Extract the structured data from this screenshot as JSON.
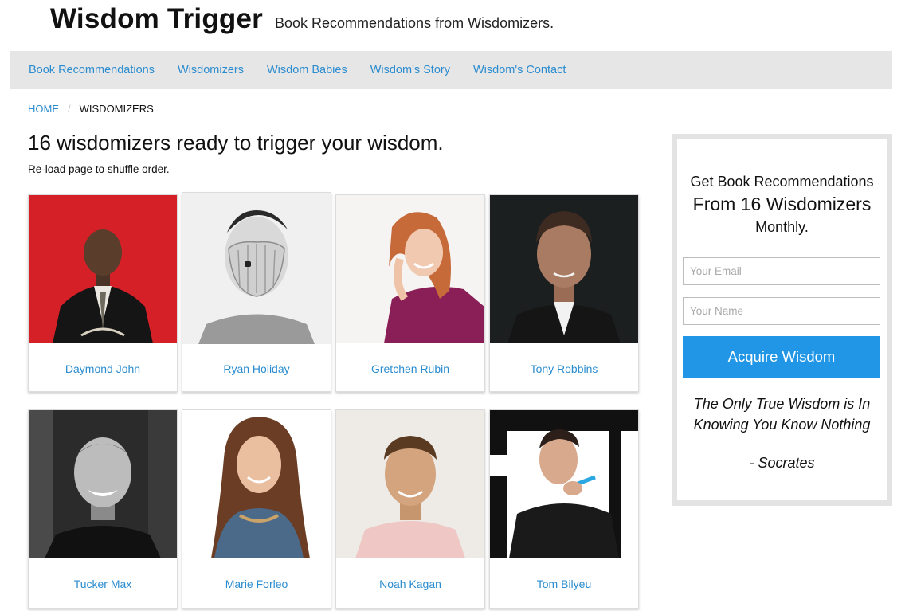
{
  "header": {
    "title": "Wisdom Trigger",
    "tagline": "Book Recommendations from Wisdomizers."
  },
  "nav": {
    "items": [
      {
        "label": "Book Recommendations"
      },
      {
        "label": "Wisdomizers"
      },
      {
        "label": "Wisdom Babies"
      },
      {
        "label": "Wisdom's Story"
      },
      {
        "label": "Wisdom's Contact"
      }
    ]
  },
  "breadcrumb": {
    "home": "HOME",
    "separator": "/",
    "current": "WISDOMIZERS"
  },
  "main": {
    "heading": "16 wisdomizers ready to trigger your wisdom.",
    "note": "Re-load page to shuffle order."
  },
  "wisdomizers": [
    {
      "name": "Daymond John"
    },
    {
      "name": "Ryan Holiday"
    },
    {
      "name": "Gretchen Rubin"
    },
    {
      "name": "Tony Robbins"
    },
    {
      "name": "Tucker Max"
    },
    {
      "name": "Marie Forleo"
    },
    {
      "name": "Noah Kagan"
    },
    {
      "name": "Tom Bilyeu"
    }
  ],
  "sidebar": {
    "line1": "Get Book Recommendations",
    "line2": "From 16 Wisdomizers",
    "line3": "Monthly.",
    "email_placeholder": "Your Email",
    "name_placeholder": "Your Name",
    "button_label": "Acquire Wisdom",
    "quote_line1": "The Only True Wisdom is In",
    "quote_line2": "Knowing You Know Nothing",
    "quote_author": "- Socrates"
  },
  "colors": {
    "link": "#2b8ccf",
    "nav_bg": "#e6e6e6",
    "button_bg": "#2196e6"
  }
}
